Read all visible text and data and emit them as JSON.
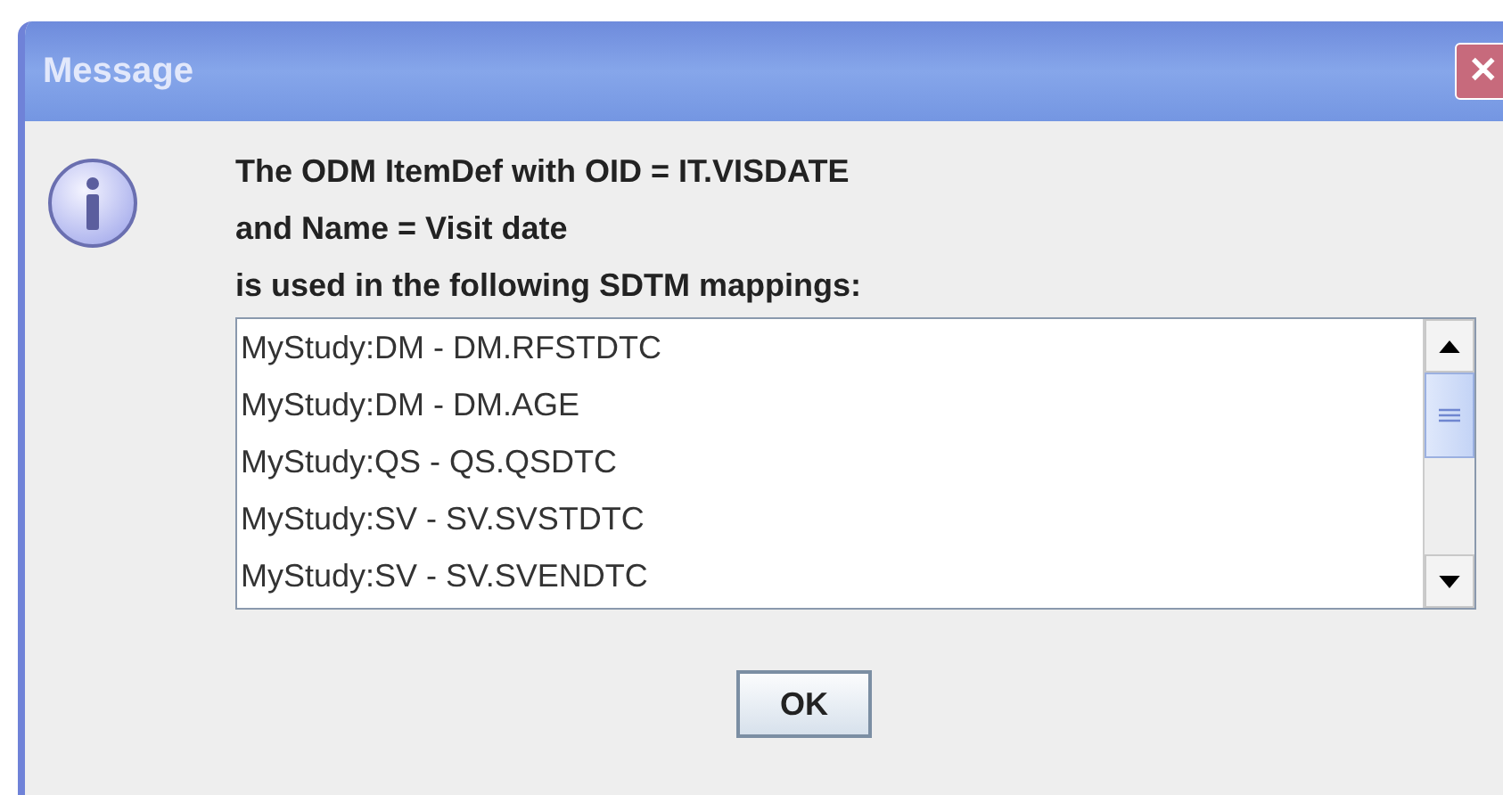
{
  "window": {
    "title": "Message",
    "close": "✕"
  },
  "message": [
    "The ODM ItemDef with OID = IT.VISDATE",
    "and Name = Visit date",
    "is used in the following SDTM mappings:"
  ],
  "list": {
    "items": [
      "MyStudy:DM - DM.RFSTDTC",
      "MyStudy:DM - DM.AGE",
      "MyStudy:QS - QS.QSDTC",
      "MyStudy:SV - SV.SVSTDTC",
      "MyStudy:SV - SV.SVENDTC"
    ]
  },
  "buttons": [
    "OK"
  ]
}
